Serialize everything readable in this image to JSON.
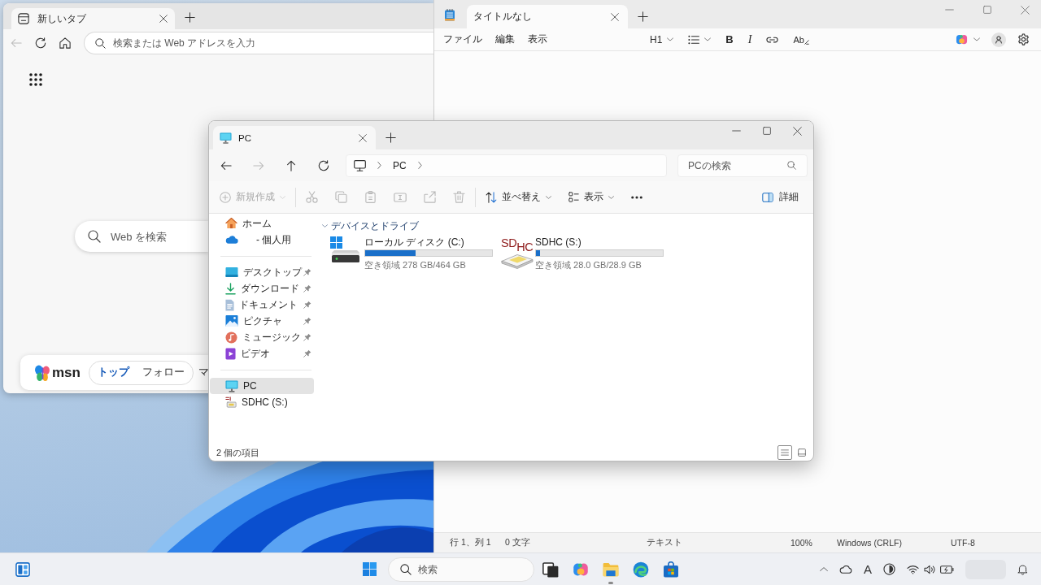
{
  "browser": {
    "tab": {
      "title": "新しいタブ"
    },
    "nav_buttons": [
      {
        "kind": "back",
        "disabled": true
      },
      {
        "kind": "refresh",
        "disabled": false
      },
      {
        "kind": "home",
        "disabled": false
      }
    ],
    "address_bar": {
      "placeholder": "検索または Web アドレスを入力"
    },
    "web_search": {
      "placeholder": "Web を検索"
    },
    "msn_bar": {
      "logo": "msn",
      "pill_tabs": [
        {
          "label": "トップ",
          "selected": true
        },
        {
          "label": "フォロー",
          "selected": false
        }
      ],
      "tabs": [
        {
          "label": "マ",
          "selected": false
        }
      ]
    }
  },
  "notepad": {
    "tab": {
      "title": "タイトルなし"
    },
    "menu": [
      "ファイル",
      "編集",
      "表示"
    ],
    "format_buttons": [
      {
        "kind": "heading",
        "label": "H1"
      },
      {
        "kind": "list"
      },
      {
        "kind": "bold",
        "label": "B"
      },
      {
        "kind": "italic",
        "label": "I"
      },
      {
        "kind": "link"
      },
      {
        "kind": "clear",
        "label": "Ab"
      }
    ],
    "status_bar": [
      "行 1、列 1",
      "0 文字",
      "テキスト",
      "100%",
      "Windows (CRLF)",
      "UTF-8"
    ]
  },
  "explorer": {
    "tab": {
      "title": "PC"
    },
    "nav_buttons": [
      {
        "kind": "back",
        "disabled": false
      },
      {
        "kind": "forward",
        "disabled": true
      },
      {
        "kind": "up",
        "disabled": false
      },
      {
        "kind": "refresh",
        "disabled": false
      }
    ],
    "breadcrumb": [
      "PC"
    ],
    "search": {
      "placeholder": "PCの検索"
    },
    "command_groups": [
      [
        {
          "kind": "new",
          "label": "新規作成",
          "disabled": true
        }
      ],
      [
        {
          "kind": "cut",
          "disabled": true
        },
        {
          "kind": "copy",
          "disabled": true
        },
        {
          "kind": "paste",
          "disabled": true
        },
        {
          "kind": "rename",
          "disabled": true
        },
        {
          "kind": "share",
          "disabled": true
        },
        {
          "kind": "delete",
          "disabled": true
        }
      ],
      [
        {
          "kind": "sort",
          "label": "並べ替え",
          "disabled": false
        },
        {
          "kind": "view",
          "label": "表示",
          "disabled": false
        },
        {
          "kind": "more",
          "disabled": false
        }
      ]
    ],
    "details_button": "詳細",
    "sidebar": {
      "groups": [
        [
          {
            "kind": "home",
            "label": "ホーム",
            "pinned": false,
            "selected": false
          },
          {
            "kind": "onedrive",
            "label": "- 個人用",
            "pinned": false,
            "selected": false
          }
        ],
        [
          {
            "kind": "desktop",
            "label": "デスクトップ",
            "pinned": true,
            "selected": false
          },
          {
            "kind": "download",
            "label": "ダウンロード",
            "pinned": true,
            "selected": false
          },
          {
            "kind": "documents",
            "label": "ドキュメント",
            "pinned": true,
            "selected": false
          },
          {
            "kind": "pictures",
            "label": "ピクチャ",
            "pinned": true,
            "selected": false
          },
          {
            "kind": "music",
            "label": "ミュージック",
            "pinned": true,
            "selected": false
          },
          {
            "kind": "videos",
            "label": "ビデオ",
            "pinned": true,
            "selected": false
          }
        ],
        [
          {
            "kind": "pc",
            "label": "PC",
            "pinned": false,
            "selected": true
          },
          {
            "kind": "sd",
            "label": "SDHC (S:)",
            "pinned": false,
            "selected": false
          }
        ]
      ]
    },
    "section": {
      "title": "デバイスとドライブ",
      "expanded": true
    },
    "drives": [
      {
        "kind": "hdd",
        "name": "ローカル ディスク (C:)",
        "level": 0.4,
        "space": "空き領域 278 GB/464 GB"
      },
      {
        "kind": "sd",
        "logo": "SD$_{HC}$",
        "name": "SDHC (S:)",
        "level": 0.03,
        "space": "空き領域 28.0 GB/28.9 GB"
      }
    ],
    "status": "2 個の項目",
    "view_modes": [
      {
        "kind": "details",
        "selected": true
      },
      {
        "kind": "tiles",
        "selected": false
      }
    ]
  },
  "taskbar": {
    "search": {
      "placeholder": "検索"
    },
    "apps": [
      {
        "kind": "task-view",
        "active": false
      },
      {
        "kind": "copilot",
        "active": false
      },
      {
        "kind": "explorer",
        "active": true
      },
      {
        "kind": "edge",
        "active": false
      },
      {
        "kind": "store",
        "active": false
      }
    ],
    "tray": {
      "ime_mode": "A"
    }
  }
}
